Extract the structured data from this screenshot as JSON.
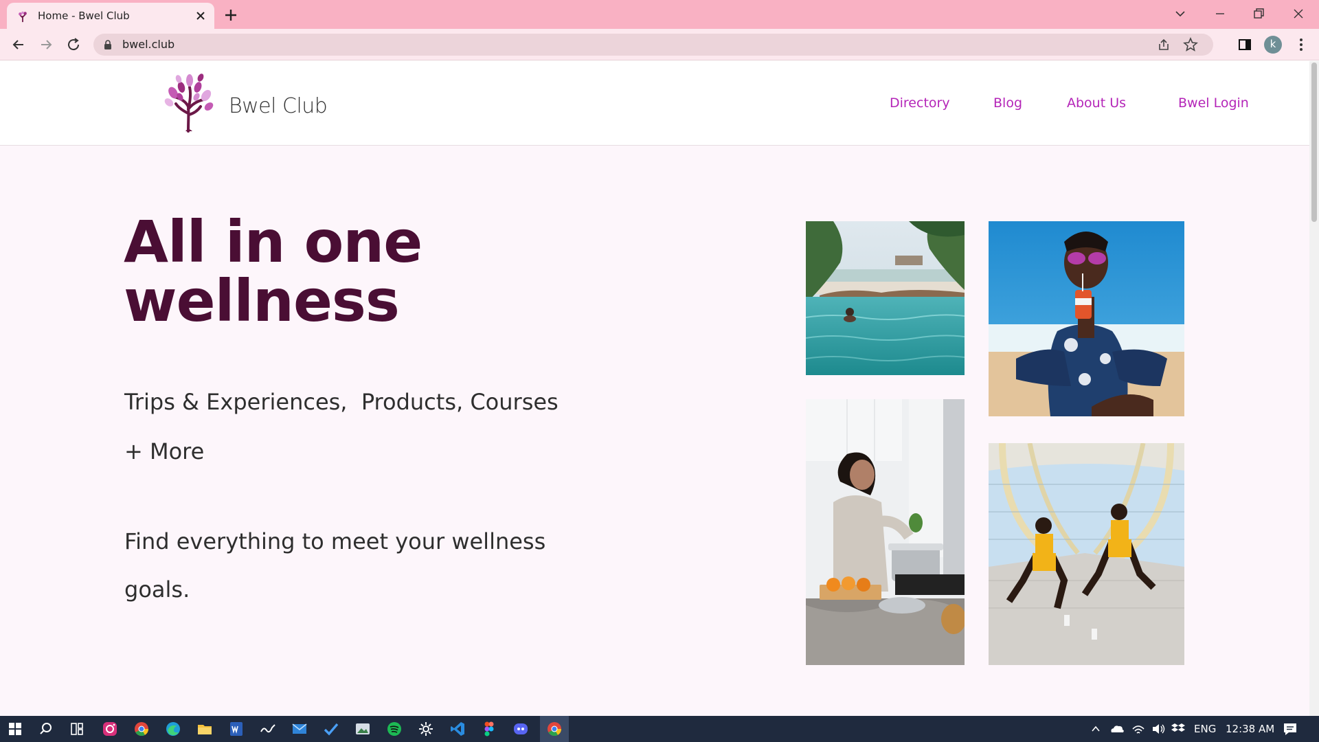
{
  "browser": {
    "tab_title": "Home - Bwel Club",
    "url": "bwel.club",
    "profile_initial": "k"
  },
  "site": {
    "logo_text": "Bwel Club",
    "nav": [
      "Directory",
      "Blog",
      "About Us",
      "Bwel Login"
    ]
  },
  "hero": {
    "title_line1": "All in one",
    "title_line2": "wellness",
    "sub_line1": "Trips & Experiences,  Products, Courses",
    "sub_line2": "+ More",
    "goal_line1": "Find everything to meet your wellness",
    "goal_line2": "goals."
  },
  "images": [
    {
      "name": "infinity-pool-photo"
    },
    {
      "name": "beach-drink-photo"
    },
    {
      "name": "kitchen-cooking-photo"
    },
    {
      "name": "bridge-workout-photo"
    }
  ],
  "taskbar": {
    "apps": [
      "start-icon",
      "search-icon",
      "task-view-icon",
      "instagram-icon",
      "chrome-icon",
      "edge-icon",
      "file-explorer-icon",
      "word-icon",
      "ink-icon",
      "mail-icon",
      "todo-icon",
      "photos-icon",
      "spotify-icon",
      "settings-icon",
      "vscode-icon",
      "figma-icon",
      "discord-icon",
      "chrome-active-icon"
    ],
    "language": "ENG",
    "time": "12:38 AM"
  },
  "colors": {
    "brand_dark": "#4a0e34",
    "nav_link": "#b425b8",
    "tab_bar": "#f9b1c3",
    "page_bg": "#fdf6fb"
  }
}
